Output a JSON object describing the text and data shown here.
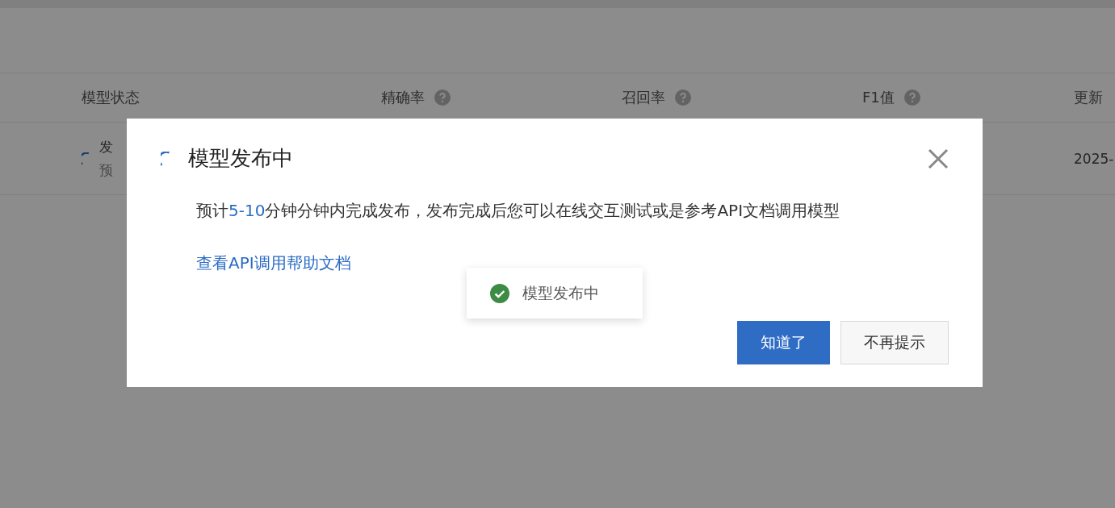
{
  "table": {
    "columns": [
      {
        "label": "模型状态",
        "help": false
      },
      {
        "label": "精确率",
        "help": true
      },
      {
        "label": "召回率",
        "help": true
      },
      {
        "label": "F1值",
        "help": true
      },
      {
        "label": "更新",
        "help": false
      }
    ],
    "rows": [
      {
        "status": "发",
        "note": "预",
        "loading": true,
        "updated": "2025-"
      }
    ]
  },
  "dialog": {
    "title": "模型发布中",
    "loading": true,
    "message": [
      {
        "kind": "plain",
        "text": "预计"
      },
      {
        "kind": "highlight",
        "text": "5-10"
      },
      {
        "kind": "plain",
        "text": "分钟分钟内完成发布，发布完成后您可以在线交互测试或是参考API文档调用模型"
      }
    ],
    "link": "查看API调用帮助文档",
    "buttons": [
      {
        "label": "知道了",
        "kind": "primary"
      },
      {
        "label": "不再提示",
        "kind": "default"
      }
    ]
  },
  "toast": {
    "text": "模型发布中",
    "kind": "success"
  }
}
